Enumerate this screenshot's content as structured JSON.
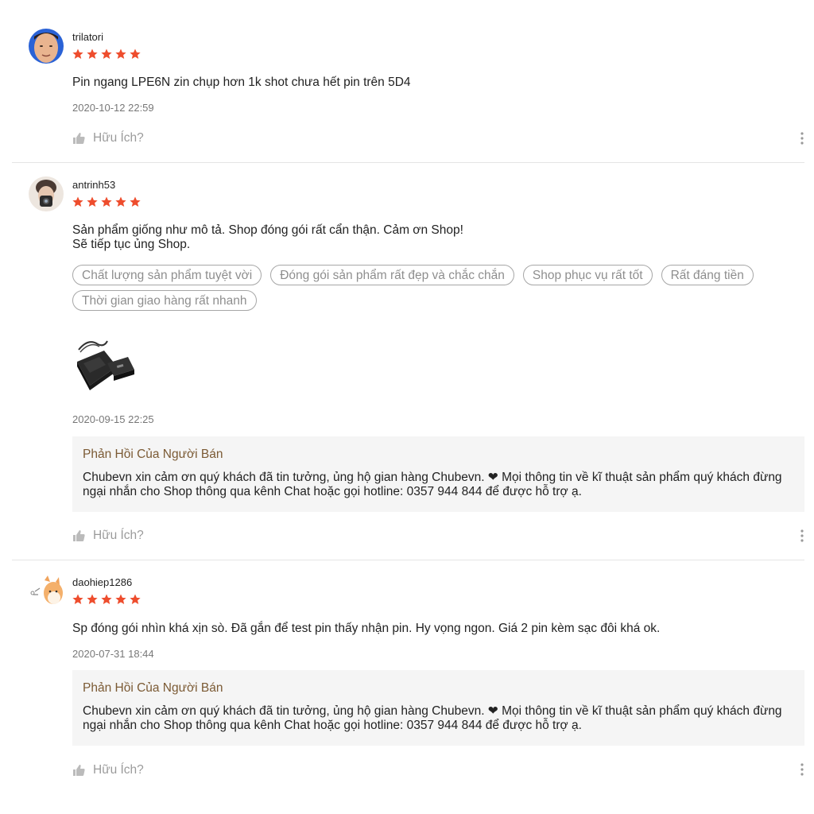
{
  "colors": {
    "star": "#ee4d2d",
    "reply_title": "#7b5a34",
    "reply_bg": "#f5f5f5"
  },
  "icons": {
    "rating": "star-icon",
    "helpful": "thumbs-up-icon",
    "menu": "more-vertical-icon"
  },
  "reviews": [
    {
      "username": "trilatori",
      "rating": 5,
      "content": "Pin ngang LPE6N zin chụp hơn 1k shot chưa hết pin trên 5D4",
      "time": "2020-10-12 22:59",
      "helpful_label": "Hữu Ích?"
    },
    {
      "username": "antrinh53",
      "rating": 5,
      "content": "Sản phẩm giống như mô tả. Shop đóng gói rất cẩn thận. Cảm ơn Shop!\nSẽ tiếp tục ủng Shop.",
      "tags": [
        "Chất lượng sản phẩm tuyệt vời",
        "Đóng gói sản phẩm rất đẹp và chắc chắn",
        "Shop phục vụ rất tốt",
        "Rất đáng tiền",
        "Thời gian giao hàng rất nhanh"
      ],
      "time": "2020-09-15 22:25",
      "reply": {
        "title": "Phản Hồi Của Người Bán",
        "text": "Chubevn xin cảm ơn quý khách đã tin tưởng, ủng hộ gian hàng Chubevn. ❤ Mọi thông tin về kĩ thuật sản phẩm quý khách đừng ngại nhắn cho Shop thông qua kênh Chat hoặc gọi hotline: 0357 944 844 để được hỗ trợ ạ."
      },
      "helpful_label": "Hữu Ích?"
    },
    {
      "username": "daohiep1286",
      "rating": 5,
      "content": "Sp đóng gói nhìn khá xịn sò. Đã gắn để test pin thấy nhận pin. Hy vọng ngon. Giá 2 pin kèm sạc đôi khá ok.",
      "time": "2020-07-31 18:44",
      "reply": {
        "title": "Phản Hồi Của Người Bán",
        "text": "Chubevn xin cảm ơn quý khách đã tin tưởng, ủng hộ gian hàng Chubevn. ❤ Mọi thông tin về kĩ thuật sản phẩm quý khách đừng ngại nhắn cho Shop thông qua kênh Chat hoặc gọi hotline: 0357 944 844 để được hỗ trợ ạ."
      },
      "helpful_label": "Hữu Ích?"
    }
  ]
}
